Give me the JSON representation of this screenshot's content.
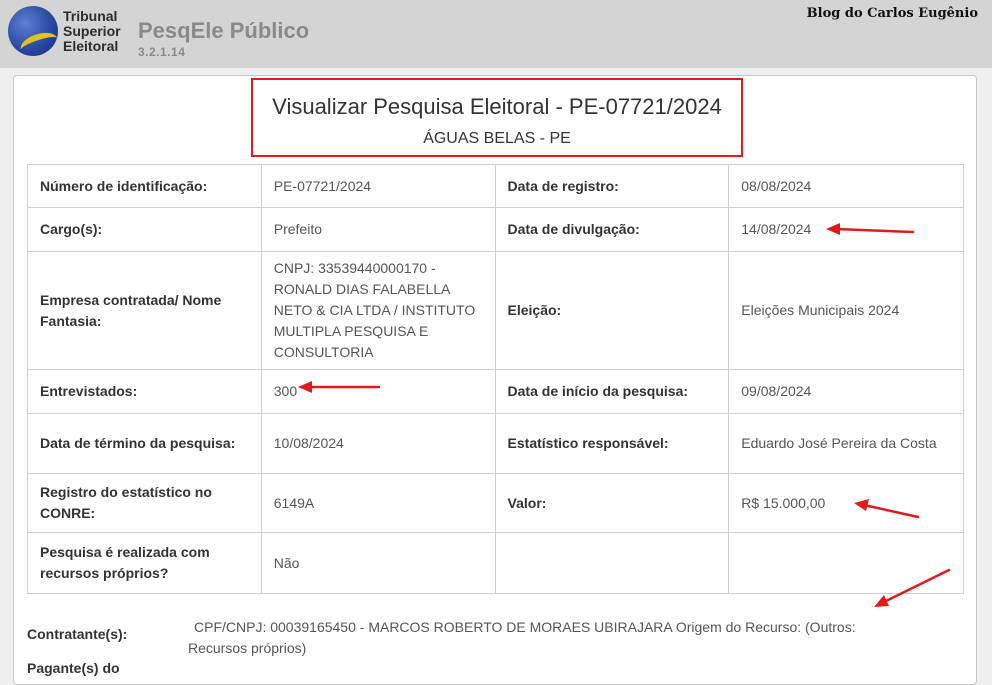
{
  "header": {
    "org_lines": [
      "Tribunal",
      "Superior",
      "Eleitoral"
    ],
    "app_title": "PesqEle Público",
    "version": "3.2.1.14",
    "blog_watermark": "Blog do Carlos Eugênio"
  },
  "title": {
    "main": "Visualizar Pesquisa Eleitoral - PE-07721/2024",
    "location": "ÁGUAS BELAS - PE"
  },
  "rows": [
    {
      "l1": "Número de identificação:",
      "v1": "PE-07721/2024",
      "l2": "Data de registro:",
      "v2": "08/08/2024"
    },
    {
      "l1": "Cargo(s):",
      "v1": "Prefeito",
      "l2": "Data de divulgação:",
      "v2": "14/08/2024"
    },
    {
      "l1": "Empresa contratada/ Nome Fantasia:",
      "v1": "CNPJ: 33539440000170 - RONALD DIAS FALABELLA NETO & CIA LTDA / INSTITUTO MULTIPLA PESQUISA E CONSULTORIA",
      "l2": "Eleição:",
      "v2": "Eleições Municipais 2024"
    },
    {
      "l1": "Entrevistados:",
      "v1": "300",
      "l2": "Data de início da pesquisa:",
      "v2": "09/08/2024"
    },
    {
      "l1": "Data de término da pesquisa:",
      "v1": "10/08/2024",
      "l2": "Estatístico responsável:",
      "v2": "Eduardo José Pereira da Costa"
    },
    {
      "l1": "Registro do estatístico no CONRE:",
      "v1": "6149A",
      "l2": "Valor:",
      "v2": "R$ 15.000,00"
    },
    {
      "l1": "Pesquisa é realizada com recursos próprios?",
      "v1": "Não",
      "l2": "",
      "v2": ""
    }
  ],
  "contratante": {
    "label": "Contratante(s):",
    "value": "CPF/CNPJ: 00039165450 - MARCOS ROBERTO DE MORAES UBIRAJARA Origem do Recurso: (Outros: Recursos próprios)"
  },
  "pagantes": {
    "label": "Pagante(s) do"
  },
  "colors": {
    "annotation_red": "#e01b1b",
    "header_bg": "#d4d4d4",
    "page_bg": "#efefef"
  }
}
